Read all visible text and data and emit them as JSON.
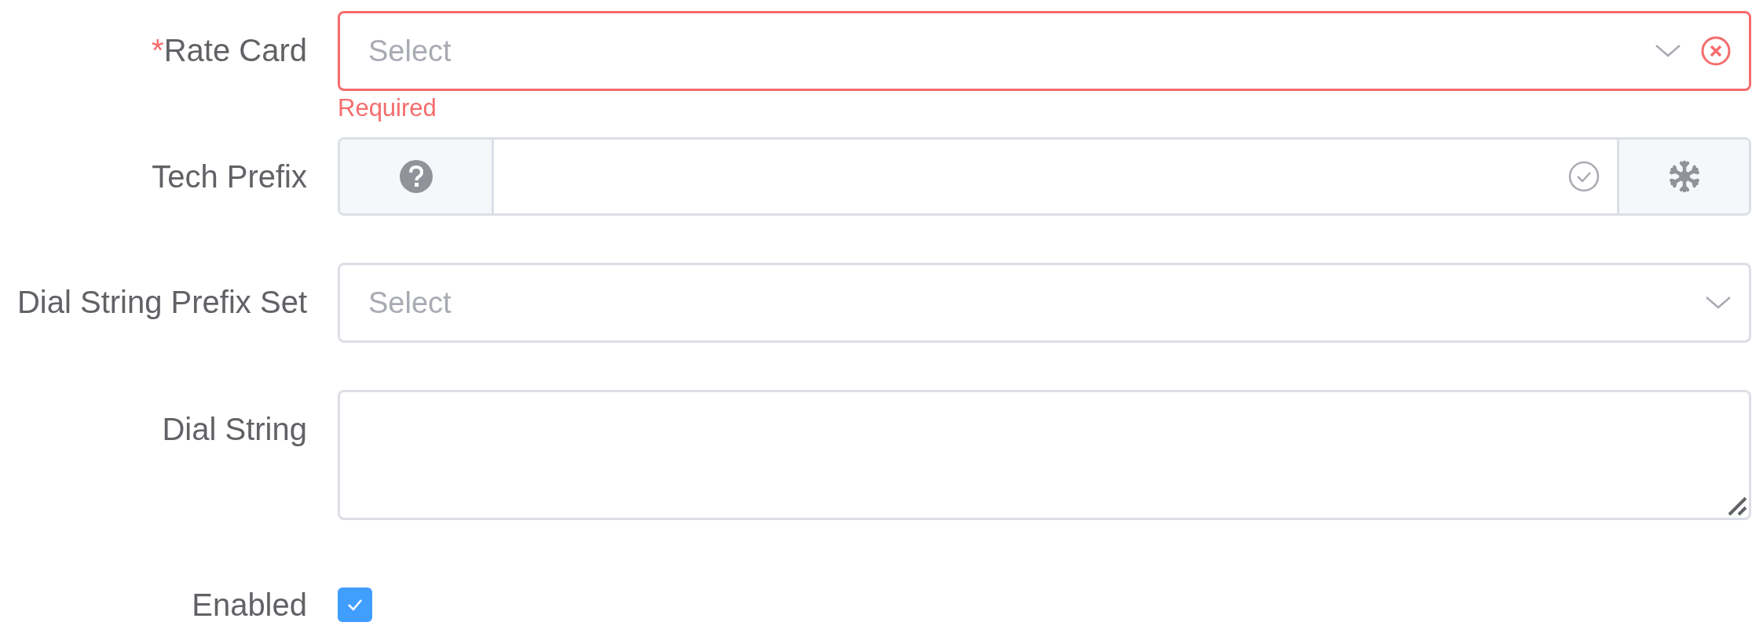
{
  "fields": [
    {
      "kind": "select",
      "label": "Rate Card",
      "required_mark": "*",
      "placeholder": "Select",
      "error": "Required",
      "clearable": true
    },
    {
      "kind": "input-group",
      "label": "Tech Prefix"
    },
    {
      "kind": "select",
      "label": "Dial String Prefix Set",
      "placeholder": "Select",
      "clearable": false
    },
    {
      "kind": "textarea",
      "label": "Dial String"
    },
    {
      "kind": "checkbox",
      "label": "Enabled",
      "checked": true
    }
  ]
}
